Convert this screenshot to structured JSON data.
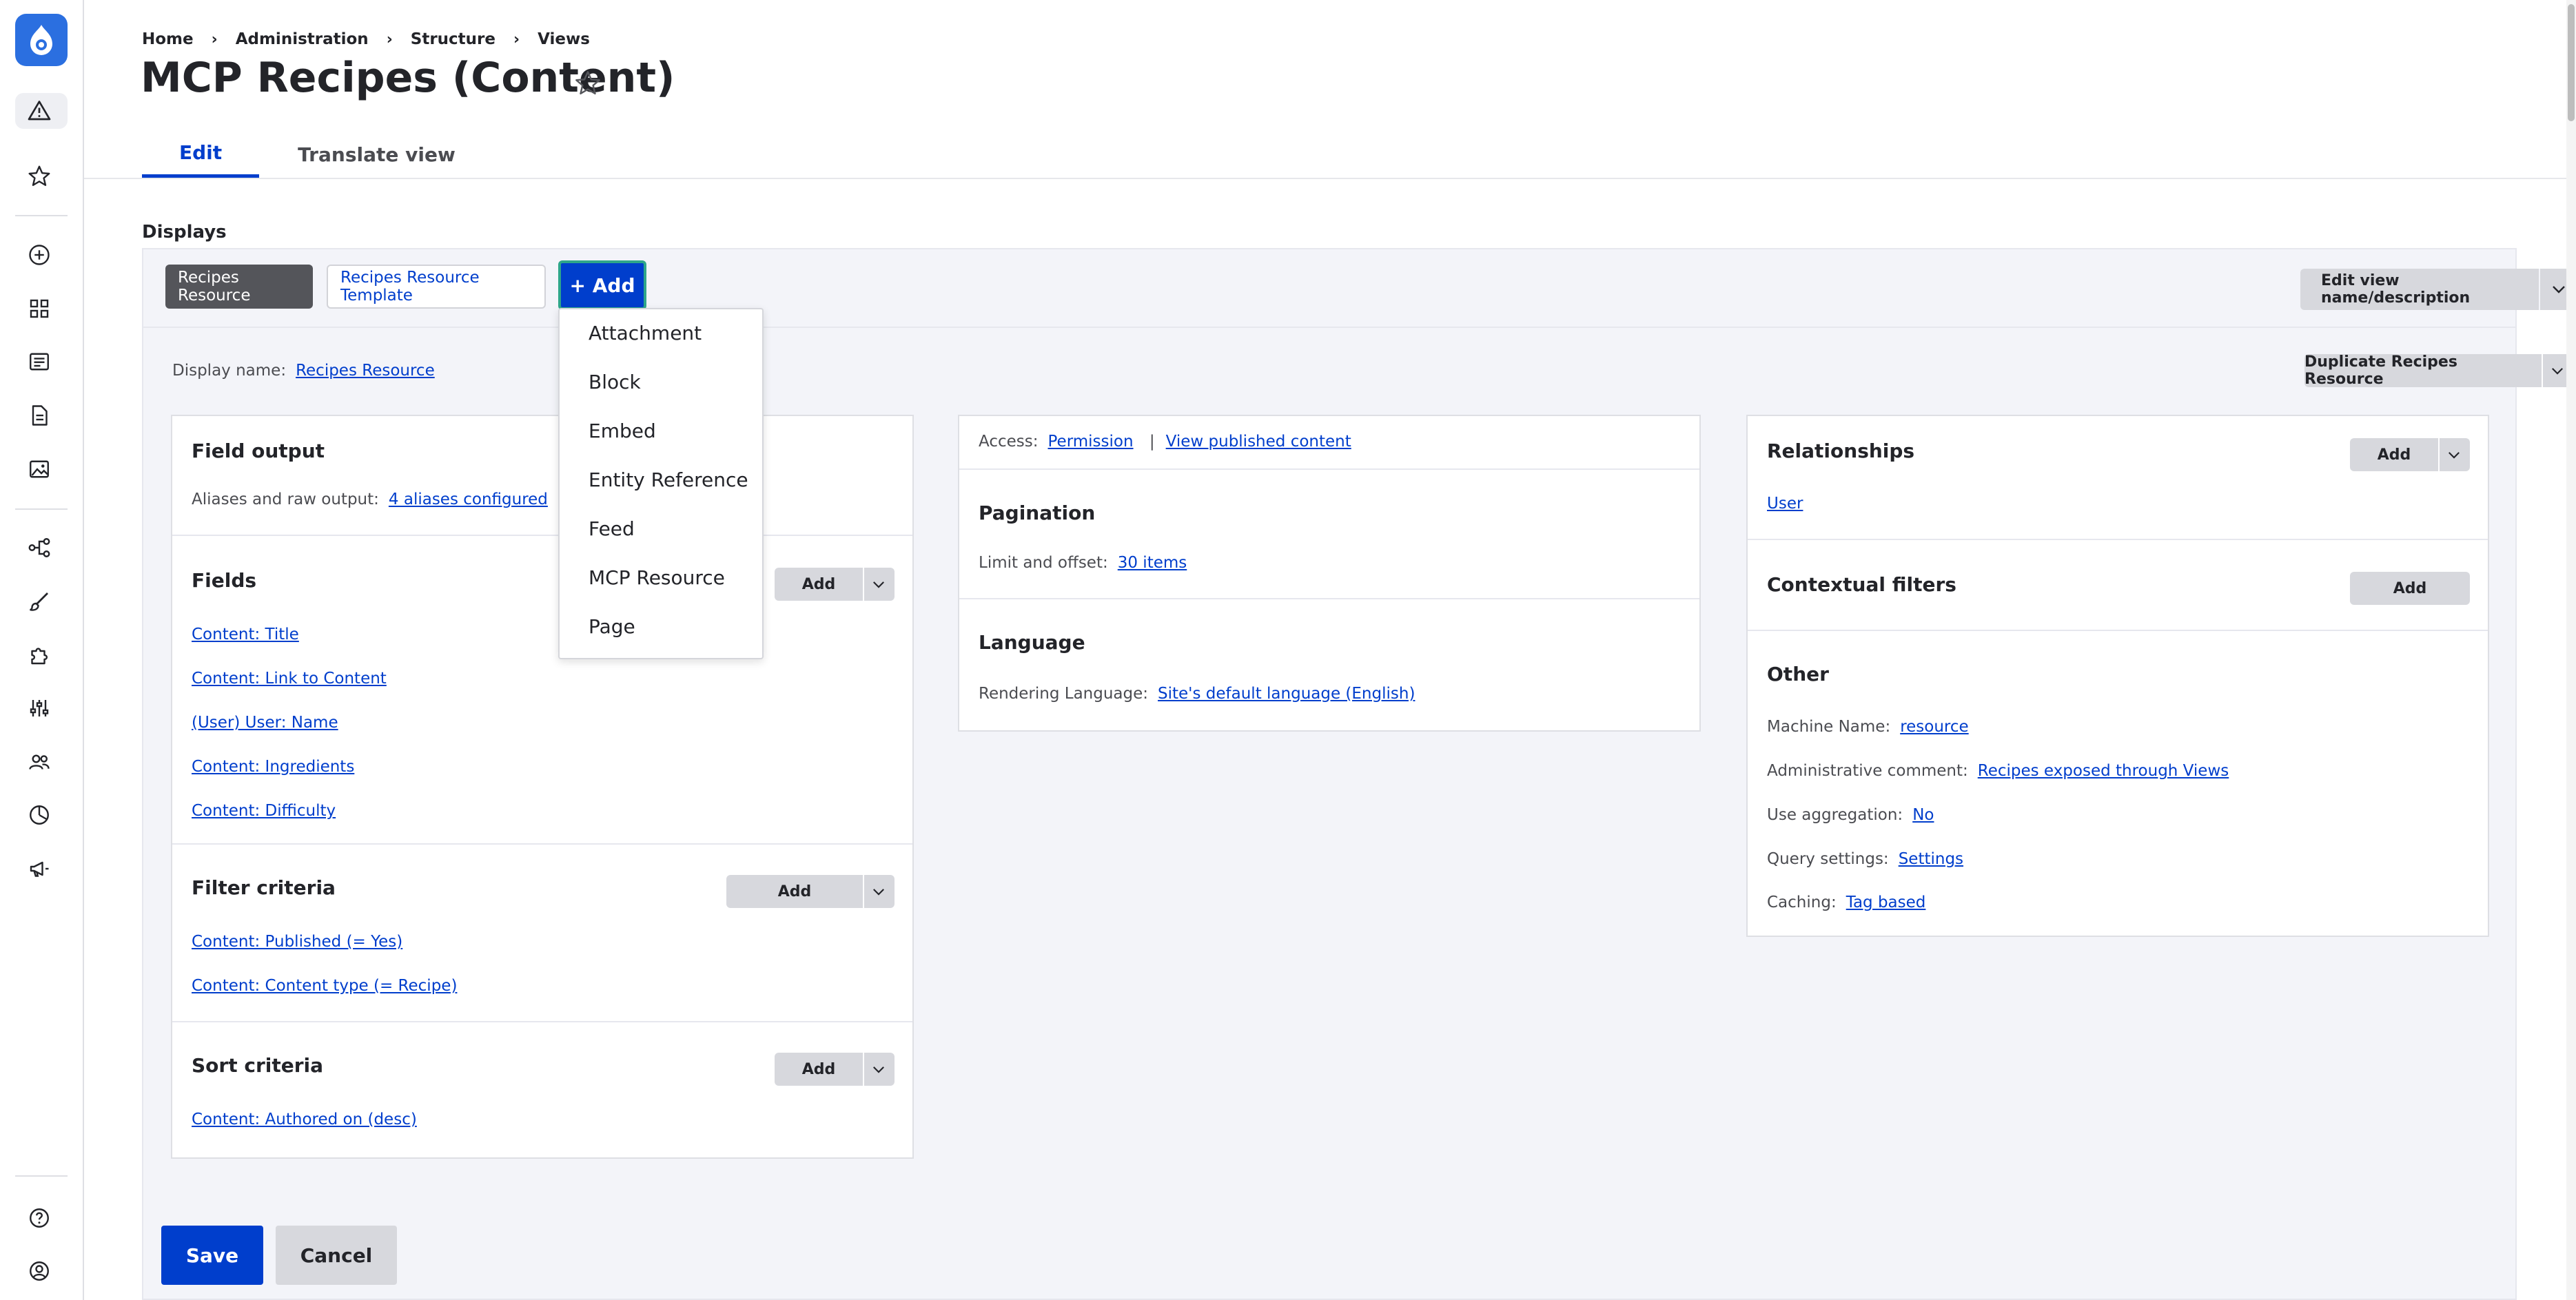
{
  "breadcrumb": [
    "Home",
    "Administration",
    "Structure",
    "Views"
  ],
  "breadcrumb_separator": "›",
  "page_title": "MCP Recipes (Content)",
  "tabs": [
    {
      "label": "Edit",
      "active": true
    },
    {
      "label": "Translate view",
      "active": false
    }
  ],
  "displays": {
    "label": "Displays",
    "tabs": [
      "Recipes Resource",
      "Recipes Resource Template"
    ],
    "add_label": "+ Add",
    "edit_view_label": "Edit view name/description",
    "display_name_label": "Display name:",
    "display_name_value": "Recipes Resource",
    "duplicate_label": "Duplicate Recipes Resource"
  },
  "add_menu": [
    "Attachment",
    "Block",
    "Embed",
    "Entity Reference",
    "Feed",
    "MCP Resource",
    "Page"
  ],
  "left_col": {
    "field_output": {
      "title": "Field output",
      "label": "Aliases and raw output:",
      "value": "4 aliases configured"
    },
    "fields": {
      "title": "Fields",
      "add": "Add",
      "items": [
        "Content: Title",
        "Content: Link to Content",
        "(User) User: Name",
        "Content: Ingredients",
        "Content: Difficulty"
      ]
    },
    "filter": {
      "title": "Filter criteria",
      "add": "Add",
      "items": [
        "Content: Published (= Yes)",
        "Content: Content type (= Recipe)"
      ]
    },
    "sort": {
      "title": "Sort criteria",
      "add": "Add",
      "items": [
        "Content: Authored on (desc)"
      ]
    }
  },
  "mid_col": {
    "access_label": "Access:",
    "access_value": "Permission",
    "access_sep": "|",
    "access_value2": "View published content",
    "pagination": {
      "title": "Pagination",
      "label": "Limit and offset:",
      "value": "30 items"
    },
    "language": {
      "title": "Language",
      "label": "Rendering Language:",
      "value": "Site's default language (English)"
    }
  },
  "right_col": {
    "relationships": {
      "title": "Relationships",
      "add": "Add",
      "items": [
        "User"
      ]
    },
    "contextual": {
      "title": "Contextual filters",
      "add": "Add"
    },
    "other": {
      "title": "Other",
      "rows": [
        {
          "label": "Machine Name:",
          "value": "resource"
        },
        {
          "label": "Administrative comment:",
          "value": "Recipes exposed through Views"
        },
        {
          "label": "Use aggregation:",
          "value": "No"
        },
        {
          "label": "Query settings:",
          "value": "Settings"
        },
        {
          "label": "Caching:",
          "value": "Tag based"
        }
      ]
    }
  },
  "footer": {
    "save": "Save",
    "cancel": "Cancel"
  },
  "colors": {
    "accent": "#003ecc",
    "logo": "#2b6fe0",
    "focus": "#2ea68a"
  }
}
